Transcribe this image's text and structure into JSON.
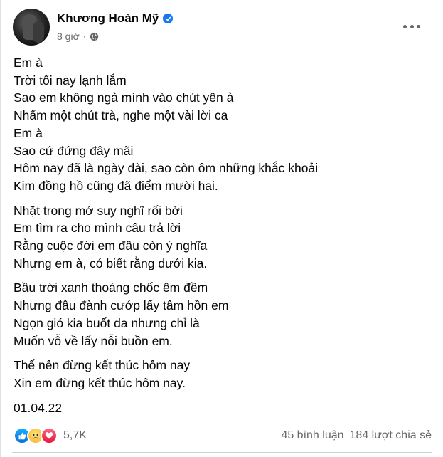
{
  "post": {
    "author": "Khương Hoàn Mỹ",
    "time": "8 giờ",
    "separator": "·",
    "stanzas": [
      [
        "Em à",
        "Trời tối nay lạnh lắm",
        "Sao em không ngả mình vào chút yên ả",
        "Nhấm một chút trà, nghe một vài lời ca",
        "Em à",
        "Sao cứ đứng đây mãi",
        "Hôm nay đã là ngày dài, sao còn ôm những khắc khoải",
        "Kim đồng hồ cũng đã điểm mười hai."
      ],
      [
        "Nhặt trong mớ suy nghĩ rối bời",
        "Em tìm ra cho mình câu trả lời",
        "Rằng cuộc đời em đâu còn ý nghĩa",
        "Nhưng em à, có biết rằng dưới kia."
      ],
      [
        "Bầu trời xanh thoáng chốc êm đềm",
        "Nhưng đâu đành cướp lấy tâm hồn em",
        "Ngọn gió kia buốt da nhưng chỉ là",
        "Muốn vỗ về lấy nỗi buồn em."
      ],
      [
        "Thế nên đừng kết thúc hôm nay",
        "Xin em đừng kết thúc hôm nay."
      ]
    ],
    "date": "01.04.22"
  },
  "footer": {
    "reaction_count": "5,7K",
    "comments": "45 bình luận",
    "shares": "184 lượt chia sẻ"
  },
  "colors": {
    "text": "#050505",
    "secondary": "#65676b",
    "brand_blue": "#1877f2"
  },
  "icons": [
    "verified-icon",
    "globe-icon",
    "more-options-icon",
    "like-reaction-icon",
    "sad-reaction-icon",
    "love-reaction-icon"
  ]
}
